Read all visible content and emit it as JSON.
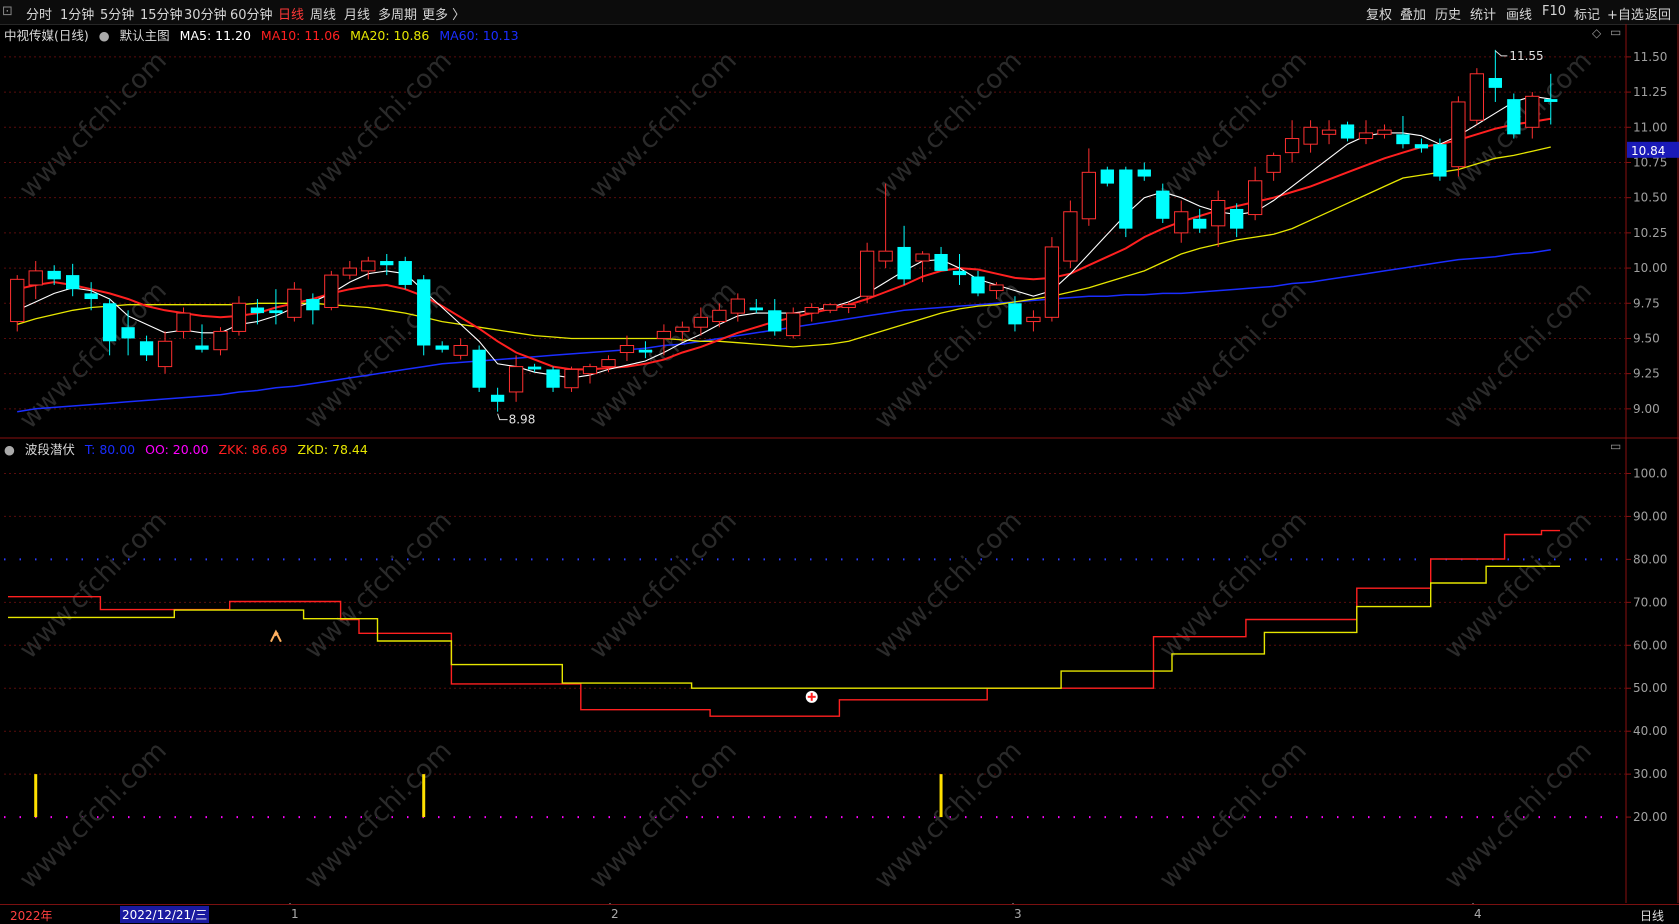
{
  "toolbar": {
    "periods": [
      "分时",
      "1分钟",
      "5分钟",
      "15分钟",
      "30分钟",
      "60分钟",
      "日线",
      "周线",
      "月线",
      "多周期",
      "更多 〉"
    ],
    "active_period": "日线",
    "right_buttons": [
      "复权",
      "叠加",
      "历史",
      "统计",
      "画线",
      "F10",
      "标记",
      "+自选",
      "返回"
    ]
  },
  "main_legend": {
    "stock": "中视传媒(日线)",
    "chart_label": "默认主图",
    "ma5": "MA5: 11.20",
    "ma10": "MA10: 11.06",
    "ma20": "MA20: 10.86",
    "ma60": "MA60: 10.13"
  },
  "sub_legend": {
    "name": "波段潜伏",
    "t": "T: 80.00",
    "oo": "OO: 20.00",
    "zkk": "ZKK: 86.69",
    "zkd": "ZKD: 78.44"
  },
  "annotations": {
    "high": "11.55",
    "low": "8.98",
    "current_price": "10.84"
  },
  "bottom_axis": {
    "year": "2022年",
    "cursor_date": "2022/12/21/三",
    "month_marks": [
      "1",
      "2",
      "3",
      "4"
    ],
    "period": "日线"
  },
  "colors": {
    "up": "#ff3030",
    "down": "#00ffff",
    "ma5": "#ffffff",
    "ma10": "#ff2020",
    "ma20": "#e6e600",
    "ma60": "#1a2dff",
    "zkk": "#ff2020",
    "zkd": "#e6e600"
  },
  "chart_data": [
    {
      "type": "candlestick",
      "title": "中视传媒(日线)",
      "ylim": [
        8.8,
        11.62
      ],
      "yticks": [
        9.0,
        9.25,
        9.5,
        9.75,
        10.0,
        10.25,
        10.5,
        10.75,
        11.0,
        11.25,
        11.5
      ],
      "ohlc": [
        [
          9.62,
          9.95,
          9.55,
          9.92
        ],
        [
          9.88,
          10.05,
          9.78,
          9.98
        ],
        [
          9.98,
          10.02,
          9.88,
          9.92
        ],
        [
          9.95,
          10.03,
          9.8,
          9.85
        ],
        [
          9.82,
          9.9,
          9.7,
          9.78
        ],
        [
          9.75,
          9.78,
          9.38,
          9.48
        ],
        [
          9.58,
          9.7,
          9.38,
          9.5
        ],
        [
          9.48,
          9.52,
          9.34,
          9.38
        ],
        [
          9.3,
          9.55,
          9.25,
          9.48
        ],
        [
          9.55,
          9.72,
          9.5,
          9.68
        ],
        [
          9.45,
          9.6,
          9.4,
          9.42
        ],
        [
          9.42,
          9.58,
          9.38,
          9.55
        ],
        [
          9.55,
          9.8,
          9.52,
          9.75
        ],
        [
          9.72,
          9.78,
          9.6,
          9.68
        ],
        [
          9.7,
          9.85,
          9.6,
          9.68
        ],
        [
          9.65,
          9.9,
          9.62,
          9.85
        ],
        [
          9.78,
          9.82,
          9.6,
          9.7
        ],
        [
          9.72,
          9.98,
          9.7,
          9.95
        ],
        [
          9.95,
          10.05,
          9.92,
          10.0
        ],
        [
          9.98,
          10.08,
          9.92,
          10.05
        ],
        [
          10.05,
          10.1,
          9.95,
          10.02
        ],
        [
          10.05,
          10.08,
          9.85,
          9.88
        ],
        [
          9.92,
          9.95,
          9.38,
          9.45
        ],
        [
          9.45,
          9.48,
          9.4,
          9.42
        ],
        [
          9.38,
          9.5,
          9.35,
          9.45
        ],
        [
          9.42,
          9.45,
          9.12,
          9.15
        ],
        [
          9.1,
          9.15,
          8.98,
          9.05
        ],
        [
          9.12,
          9.38,
          9.05,
          9.3
        ],
        [
          9.3,
          9.32,
          9.26,
          9.28
        ],
        [
          9.28,
          9.3,
          9.12,
          9.15
        ],
        [
          9.15,
          9.3,
          9.12,
          9.28
        ],
        [
          9.25,
          9.32,
          9.18,
          9.3
        ],
        [
          9.3,
          9.38,
          9.26,
          9.35
        ],
        [
          9.4,
          9.52,
          9.34,
          9.45
        ],
        [
          9.42,
          9.48,
          9.36,
          9.4
        ],
        [
          9.5,
          9.6,
          9.38,
          9.55
        ],
        [
          9.55,
          9.62,
          9.48,
          9.58
        ],
        [
          9.58,
          9.72,
          9.52,
          9.65
        ],
        [
          9.62,
          9.75,
          9.58,
          9.7
        ],
        [
          9.68,
          9.82,
          9.62,
          9.78
        ],
        [
          9.72,
          9.78,
          9.68,
          9.7
        ],
        [
          9.7,
          9.78,
          9.52,
          9.55
        ],
        [
          9.52,
          9.72,
          9.5,
          9.68
        ],
        [
          9.68,
          9.75,
          9.62,
          9.72
        ],
        [
          9.7,
          9.75,
          9.68,
          9.74
        ],
        [
          9.72,
          9.76,
          9.68,
          9.74
        ],
        [
          9.8,
          10.18,
          9.75,
          10.12
        ],
        [
          10.05,
          10.6,
          10.0,
          10.12
        ],
        [
          10.15,
          10.3,
          9.88,
          9.92
        ],
        [
          10.05,
          10.12,
          9.9,
          10.1
        ],
        [
          10.1,
          10.15,
          10.0,
          9.98
        ],
        [
          9.98,
          10.1,
          9.88,
          9.95
        ],
        [
          9.94,
          9.98,
          9.8,
          9.82
        ],
        [
          9.84,
          9.9,
          9.78,
          9.88
        ],
        [
          9.75,
          9.8,
          9.55,
          9.6
        ],
        [
          9.62,
          9.7,
          9.55,
          9.65
        ],
        [
          9.65,
          10.22,
          9.62,
          10.15
        ],
        [
          10.05,
          10.48,
          10.0,
          10.4
        ],
        [
          10.35,
          10.85,
          10.3,
          10.68
        ],
        [
          10.7,
          10.72,
          10.58,
          10.6
        ],
        [
          10.7,
          10.72,
          10.22,
          10.28
        ],
        [
          10.7,
          10.75,
          10.62,
          10.65
        ],
        [
          10.55,
          10.6,
          10.32,
          10.35
        ],
        [
          10.25,
          10.48,
          10.18,
          10.4
        ],
        [
          10.35,
          10.42,
          10.25,
          10.28
        ],
        [
          10.3,
          10.55,
          10.15,
          10.48
        ],
        [
          10.42,
          10.46,
          10.22,
          10.28
        ],
        [
          10.38,
          10.72,
          10.34,
          10.62
        ],
        [
          10.68,
          10.82,
          10.62,
          10.8
        ],
        [
          10.82,
          11.05,
          10.75,
          10.92
        ],
        [
          10.88,
          11.05,
          10.82,
          11.0
        ],
        [
          10.95,
          11.05,
          10.88,
          10.98
        ],
        [
          11.02,
          11.04,
          10.9,
          10.92
        ],
        [
          10.92,
          11.05,
          10.88,
          10.96
        ],
        [
          10.95,
          11.02,
          10.92,
          10.98
        ],
        [
          10.95,
          11.08,
          10.85,
          10.88
        ],
        [
          10.88,
          10.92,
          10.82,
          10.85
        ],
        [
          10.88,
          10.92,
          10.62,
          10.65
        ],
        [
          10.72,
          11.22,
          10.65,
          11.18
        ],
        [
          11.05,
          11.42,
          11.02,
          11.38
        ],
        [
          11.35,
          11.55,
          11.18,
          11.28
        ],
        [
          11.2,
          11.24,
          10.92,
          10.95
        ],
        [
          11.0,
          11.25,
          10.92,
          11.22
        ],
        [
          11.2,
          11.38,
          11.02,
          11.18
        ]
      ],
      "ma5": [
        9.7,
        9.76,
        9.82,
        9.86,
        9.84,
        9.78,
        9.66,
        9.6,
        9.54,
        9.56,
        9.54,
        9.54,
        9.6,
        9.62,
        9.66,
        9.72,
        9.76,
        9.82,
        9.9,
        9.96,
        9.98,
        9.96,
        9.84,
        9.72,
        9.6,
        9.48,
        9.32,
        9.3,
        9.26,
        9.24,
        9.22,
        9.24,
        9.28,
        9.31,
        9.34,
        9.4,
        9.47,
        9.53,
        9.6,
        9.66,
        9.68,
        9.68,
        9.68,
        9.7,
        9.72,
        9.76,
        9.82,
        9.9,
        9.98,
        10.05,
        10.06,
        10.0,
        9.92,
        9.88,
        9.84,
        9.8,
        9.84,
        9.96,
        10.1,
        10.24,
        10.38,
        10.5,
        10.54,
        10.5,
        10.44,
        10.4,
        10.38,
        10.4,
        10.48,
        10.58,
        10.68,
        10.78,
        10.88,
        10.94,
        10.96,
        10.96,
        10.94,
        10.88,
        10.94,
        11.02,
        11.1,
        11.18,
        11.22,
        11.2
      ],
      "ma10": [
        9.85,
        9.88,
        9.9,
        9.88,
        9.85,
        9.82,
        9.78,
        9.73,
        9.7,
        9.68,
        9.66,
        9.65,
        9.66,
        9.68,
        9.72,
        9.75,
        9.78,
        9.82,
        9.85,
        9.87,
        9.88,
        9.85,
        9.8,
        9.73,
        9.65,
        9.57,
        9.48,
        9.4,
        9.35,
        9.3,
        9.28,
        9.28,
        9.29,
        9.3,
        9.32,
        9.35,
        9.4,
        9.44,
        9.49,
        9.54,
        9.58,
        9.62,
        9.65,
        9.68,
        9.71,
        9.74,
        9.78,
        9.83,
        9.88,
        9.94,
        9.98,
        10.0,
        9.99,
        9.96,
        9.93,
        9.92,
        9.93,
        9.96,
        10.02,
        10.08,
        10.14,
        10.22,
        10.28,
        10.33,
        10.37,
        10.41,
        10.44,
        10.47,
        10.5,
        10.54,
        10.58,
        10.63,
        10.68,
        10.73,
        10.78,
        10.82,
        10.86,
        10.88,
        10.91,
        10.95,
        10.99,
        11.02,
        11.04,
        11.06
      ],
      "ma20": [
        9.6,
        9.64,
        9.67,
        9.7,
        9.72,
        9.73,
        9.74,
        9.74,
        9.74,
        9.74,
        9.74,
        9.74,
        9.74,
        9.75,
        9.75,
        9.75,
        9.75,
        9.74,
        9.73,
        9.72,
        9.7,
        9.68,
        9.65,
        9.62,
        9.6,
        9.58,
        9.56,
        9.54,
        9.52,
        9.51,
        9.5,
        9.5,
        9.5,
        9.5,
        9.5,
        9.5,
        9.49,
        9.48,
        9.48,
        9.47,
        9.46,
        9.45,
        9.44,
        9.45,
        9.46,
        9.48,
        9.52,
        9.56,
        9.6,
        9.64,
        9.68,
        9.71,
        9.73,
        9.74,
        9.76,
        9.78,
        9.8,
        9.83,
        9.86,
        9.9,
        9.94,
        9.98,
        10.04,
        10.1,
        10.14,
        10.17,
        10.2,
        10.22,
        10.24,
        10.28,
        10.34,
        10.4,
        10.46,
        10.52,
        10.58,
        10.64,
        10.66,
        10.68,
        10.7,
        10.74,
        10.78,
        10.8,
        10.83,
        10.86
      ],
      "ma60": [
        8.98,
        9.0,
        9.01,
        9.02,
        9.03,
        9.04,
        9.05,
        9.06,
        9.07,
        9.08,
        9.09,
        9.1,
        9.12,
        9.13,
        9.15,
        9.16,
        9.18,
        9.2,
        9.22,
        9.24,
        9.26,
        9.28,
        9.3,
        9.32,
        9.33,
        9.34,
        9.35,
        9.36,
        9.37,
        9.38,
        9.39,
        9.4,
        9.41,
        9.42,
        9.43,
        9.45,
        9.46,
        9.48,
        9.5,
        9.52,
        9.54,
        9.56,
        9.58,
        9.6,
        9.62,
        9.64,
        9.66,
        9.68,
        9.7,
        9.71,
        9.72,
        9.73,
        9.74,
        9.75,
        9.76,
        9.77,
        9.78,
        9.79,
        9.8,
        9.8,
        9.81,
        9.81,
        9.82,
        9.82,
        9.83,
        9.84,
        9.85,
        9.86,
        9.87,
        9.89,
        9.9,
        9.92,
        9.94,
        9.96,
        9.98,
        10.0,
        10.02,
        10.04,
        10.06,
        10.07,
        10.08,
        10.1,
        10.11,
        10.13
      ]
    },
    {
      "type": "line",
      "title": "波段潜伏",
      "ylim": [
        0,
        105
      ],
      "yticks": [
        20.0,
        30.0,
        40.0,
        50.0,
        60.0,
        70.0,
        80.0,
        90.0,
        100.0
      ],
      "reference_lines": {
        "T": 80.0,
        "OO": 20.0
      },
      "zkk": [
        71.3,
        71.3,
        71.3,
        71.3,
        71.3,
        68.3,
        68.3,
        68.3,
        68.3,
        68.3,
        68.3,
        68.3,
        70.2,
        70.2,
        70.2,
        70.2,
        70.2,
        70.2,
        66.0,
        62.8,
        62.8,
        62.8,
        62.8,
        62.8,
        51.0,
        51.0,
        51.0,
        51.0,
        51.0,
        51.0,
        51.0,
        45.0,
        45.0,
        45.0,
        45.0,
        45.0,
        45.0,
        45.0,
        43.5,
        43.5,
        43.5,
        43.5,
        43.5,
        43.5,
        43.5,
        47.3,
        47.3,
        47.3,
        47.3,
        47.3,
        47.3,
        47.3,
        47.3,
        50.0,
        50.0,
        50.0,
        50.0,
        50.0,
        50.0,
        50.0,
        50.0,
        50.0,
        62.0,
        62.0,
        62.0,
        62.0,
        62.0,
        66.0,
        66.0,
        66.0,
        66.0,
        66.0,
        66.0,
        73.3,
        73.3,
        73.3,
        73.3,
        80.1,
        80.1,
        80.1,
        80.1,
        85.8,
        85.8,
        86.7
      ],
      "zkd": [
        66.5,
        66.5,
        66.5,
        66.5,
        66.5,
        66.5,
        66.5,
        66.5,
        66.5,
        68.2,
        68.2,
        68.2,
        68.2,
        68.2,
        68.2,
        68.2,
        66.2,
        66.2,
        66.2,
        66.2,
        61.0,
        61.0,
        61.0,
        61.0,
        55.5,
        55.5,
        55.5,
        55.5,
        55.5,
        55.5,
        51.2,
        51.2,
        51.2,
        51.2,
        51.2,
        51.2,
        51.2,
        50.0,
        50.0,
        50.0,
        50.0,
        50.0,
        50.0,
        50.0,
        50.0,
        50.0,
        50.0,
        50.0,
        50.0,
        50.0,
        50.0,
        50.0,
        50.0,
        50.0,
        50.0,
        50.0,
        50.0,
        54.0,
        54.0,
        54.0,
        54.0,
        54.0,
        54.0,
        58.0,
        58.0,
        58.0,
        58.0,
        58.0,
        63.0,
        63.0,
        63.0,
        63.0,
        63.0,
        69.0,
        69.0,
        69.0,
        69.0,
        74.5,
        74.5,
        74.5,
        78.4,
        78.4,
        78.4,
        78.4
      ],
      "signal_bars": [
        {
          "index": 1,
          "value": 30.0
        },
        {
          "index": 22,
          "value": 30.0
        },
        {
          "index": 50,
          "value": 30.0
        }
      ],
      "markers": [
        {
          "index": 14,
          "value": 62.0,
          "kind": "person"
        },
        {
          "index": 43,
          "value": 48.0,
          "kind": "plus"
        }
      ]
    }
  ]
}
